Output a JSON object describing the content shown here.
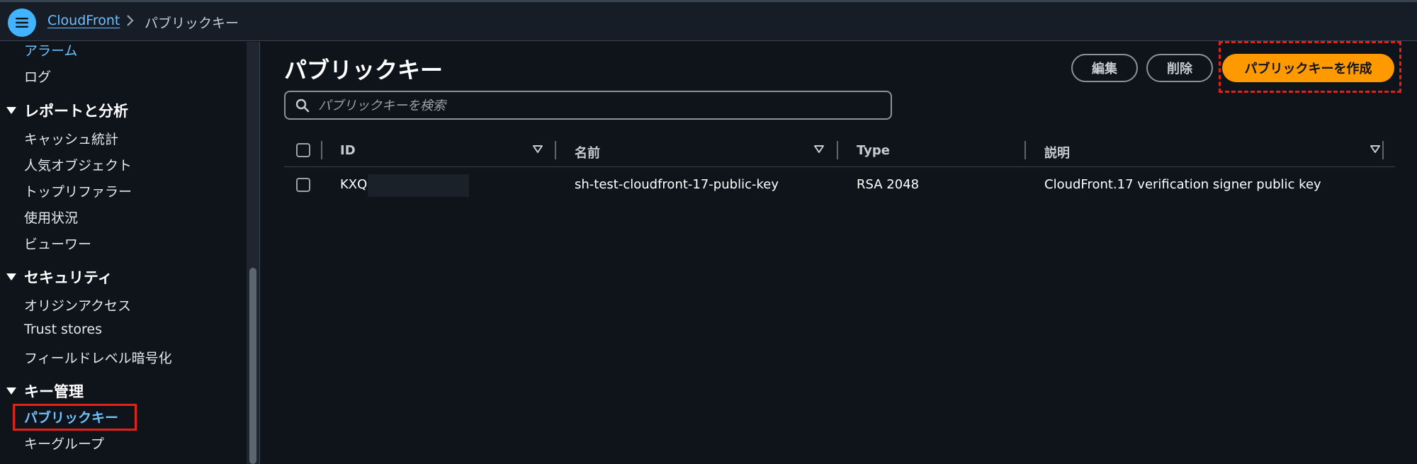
{
  "breadcrumb": {
    "service": "CloudFront",
    "current": "パブリックキー"
  },
  "sidebar": {
    "top_items": [
      "アラーム",
      "ログ"
    ],
    "sections": [
      {
        "title": "レポートと分析",
        "items": [
          "キャッシュ統計",
          "人気オブジェクト",
          "トップリファラー",
          "使用状況",
          "ビューワー"
        ]
      },
      {
        "title": "セキュリティ",
        "items": [
          "オリジンアクセス",
          "Trust stores",
          "フィールドレベル暗号化"
        ]
      },
      {
        "title": "キー管理",
        "items": [
          "パブリックキー",
          "キーグループ"
        ]
      }
    ]
  },
  "page": {
    "title": "パブリックキー",
    "edit_label": "編集",
    "delete_label": "削除",
    "create_label": "パブリックキーを作成",
    "search_placeholder": "パブリックキーを検索"
  },
  "table": {
    "columns": [
      "ID",
      "名前",
      "Type",
      "説明"
    ],
    "rows": [
      {
        "id": "KXQ",
        "name": "sh-test-cloudfront-17-public-key",
        "type": "RSA 2048",
        "description": "CloudFront.17 verification signer public key"
      }
    ]
  },
  "colors": {
    "accent": "#ff9900",
    "link": "#6fc0ff",
    "highlight": "#e0231a"
  }
}
